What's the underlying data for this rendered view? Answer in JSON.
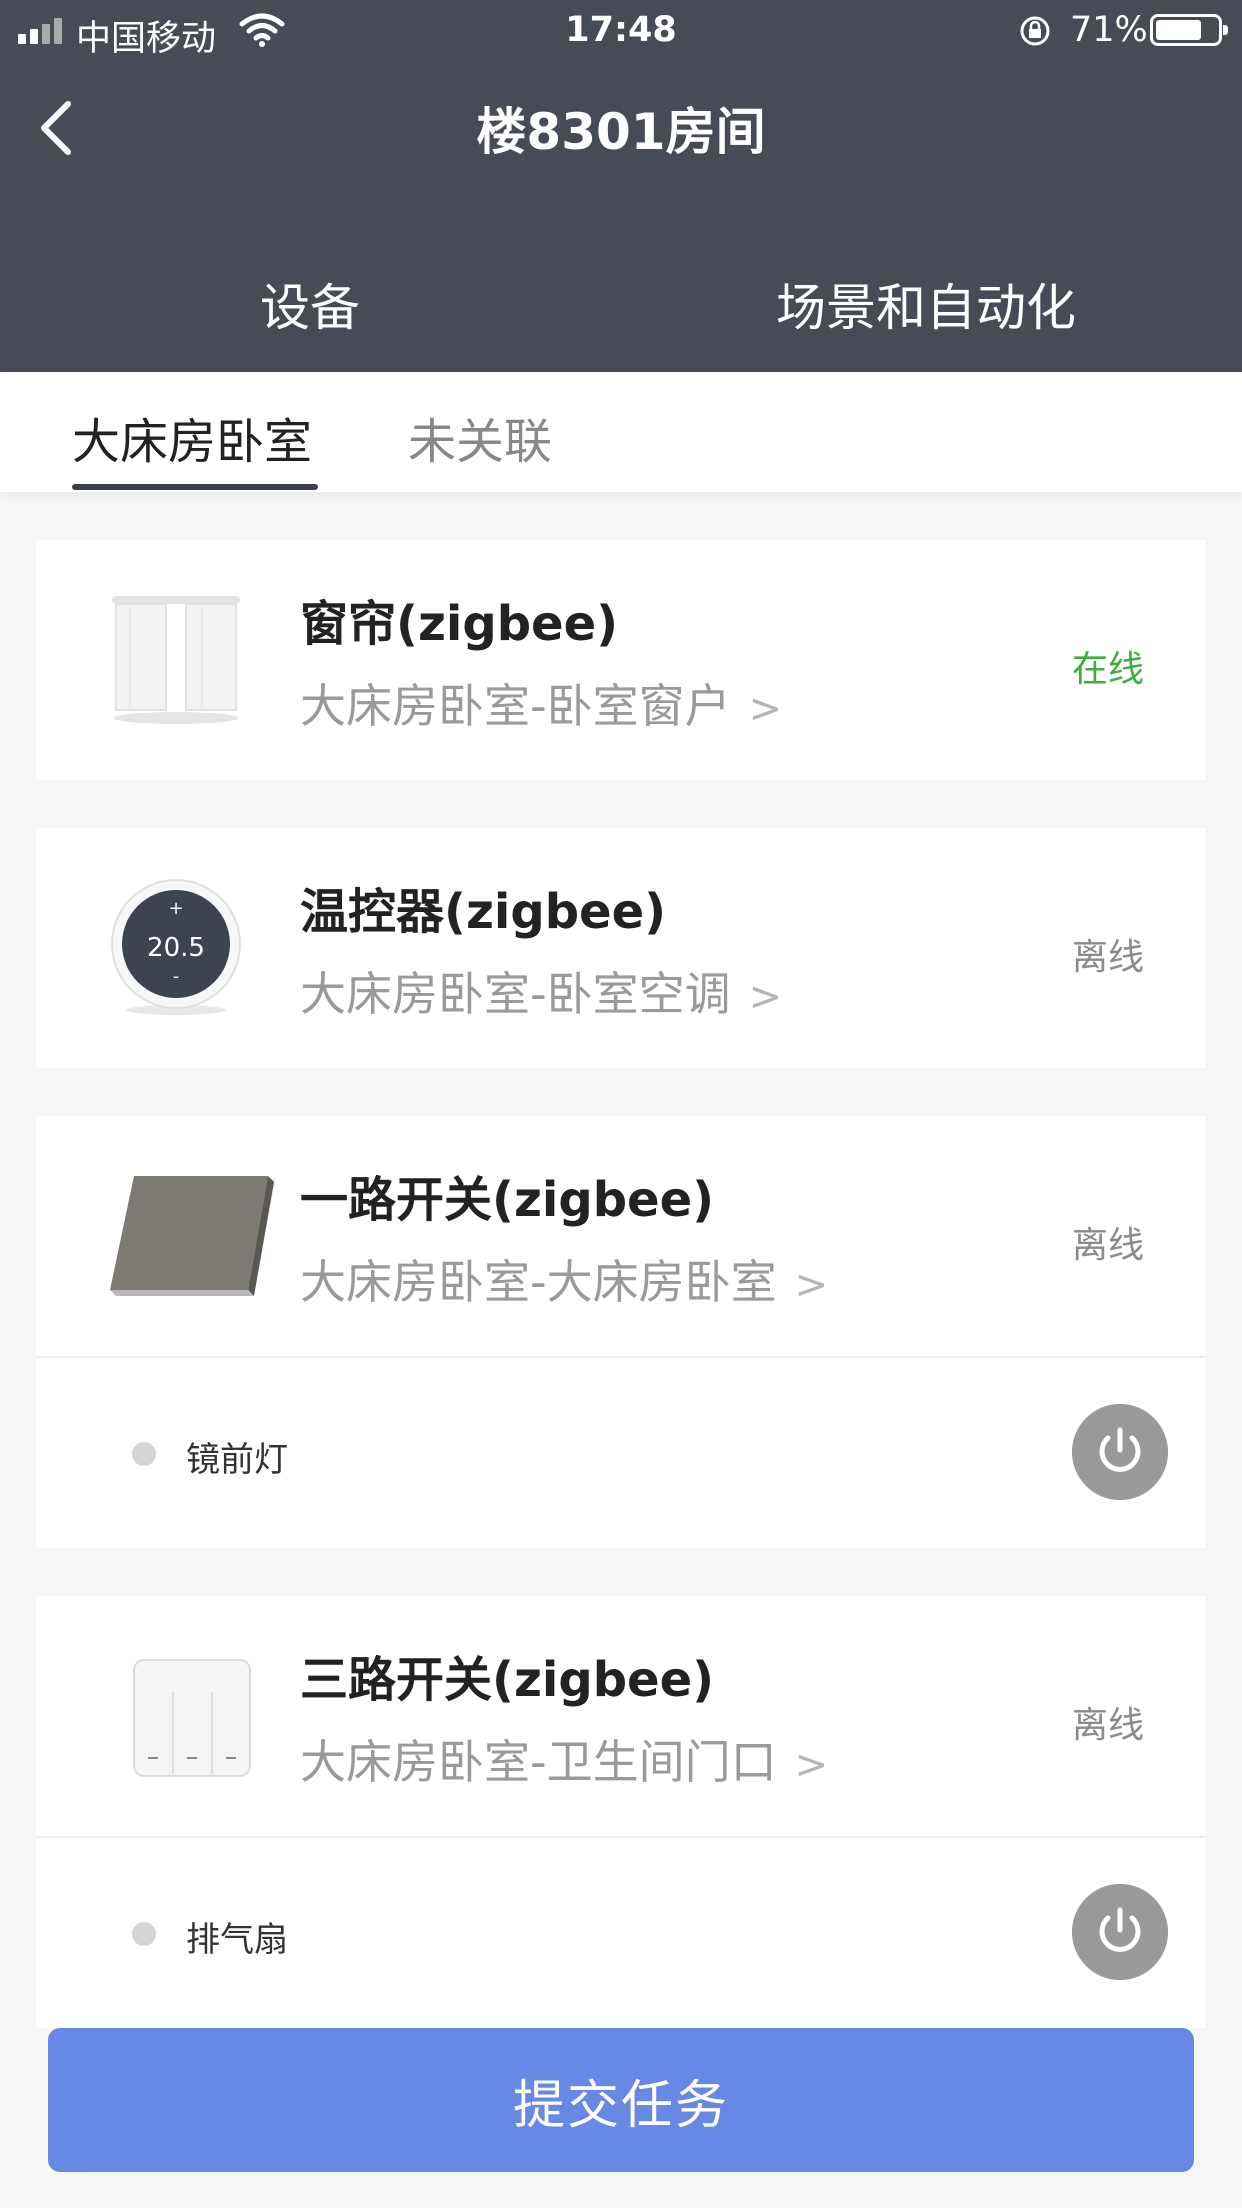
{
  "status_bar": {
    "carrier": "中国移动",
    "time": "17:48",
    "battery": "71%"
  },
  "header": {
    "title": "楼8301房间",
    "tabs": [
      "设备",
      "场景和自动化"
    ]
  },
  "subtabs": {
    "active": "大床房卧室",
    "inactive": "未关联"
  },
  "devices": [
    {
      "name": "窗帘(zigbee)",
      "location": "大床房卧室-卧室窗户",
      "status": "在线",
      "icon": "curtain-icon"
    },
    {
      "name": "温控器(zigbee)",
      "location": "大床房卧室-卧室空调",
      "status": "离线",
      "icon": "thermostat-icon",
      "display": "20.5",
      "plus": "+",
      "minus": "-"
    },
    {
      "name": "一路开关(zigbee)",
      "location": "大床房卧室-大床房卧室",
      "status": "离线",
      "icon": "switch-panel-icon",
      "channel": "镜前灯"
    },
    {
      "name": "三路开关(zigbee)",
      "location": "大床房卧室-卫生间门口",
      "status": "离线",
      "icon": "triple-switch-icon",
      "channel": "排气扇"
    }
  ],
  "submit_label": "提交任务",
  "chevron": ">",
  "colors": {
    "header_bg": "#474b55",
    "online": "#3fae3f",
    "submit": "#6788e3",
    "power_button": "#999999"
  }
}
